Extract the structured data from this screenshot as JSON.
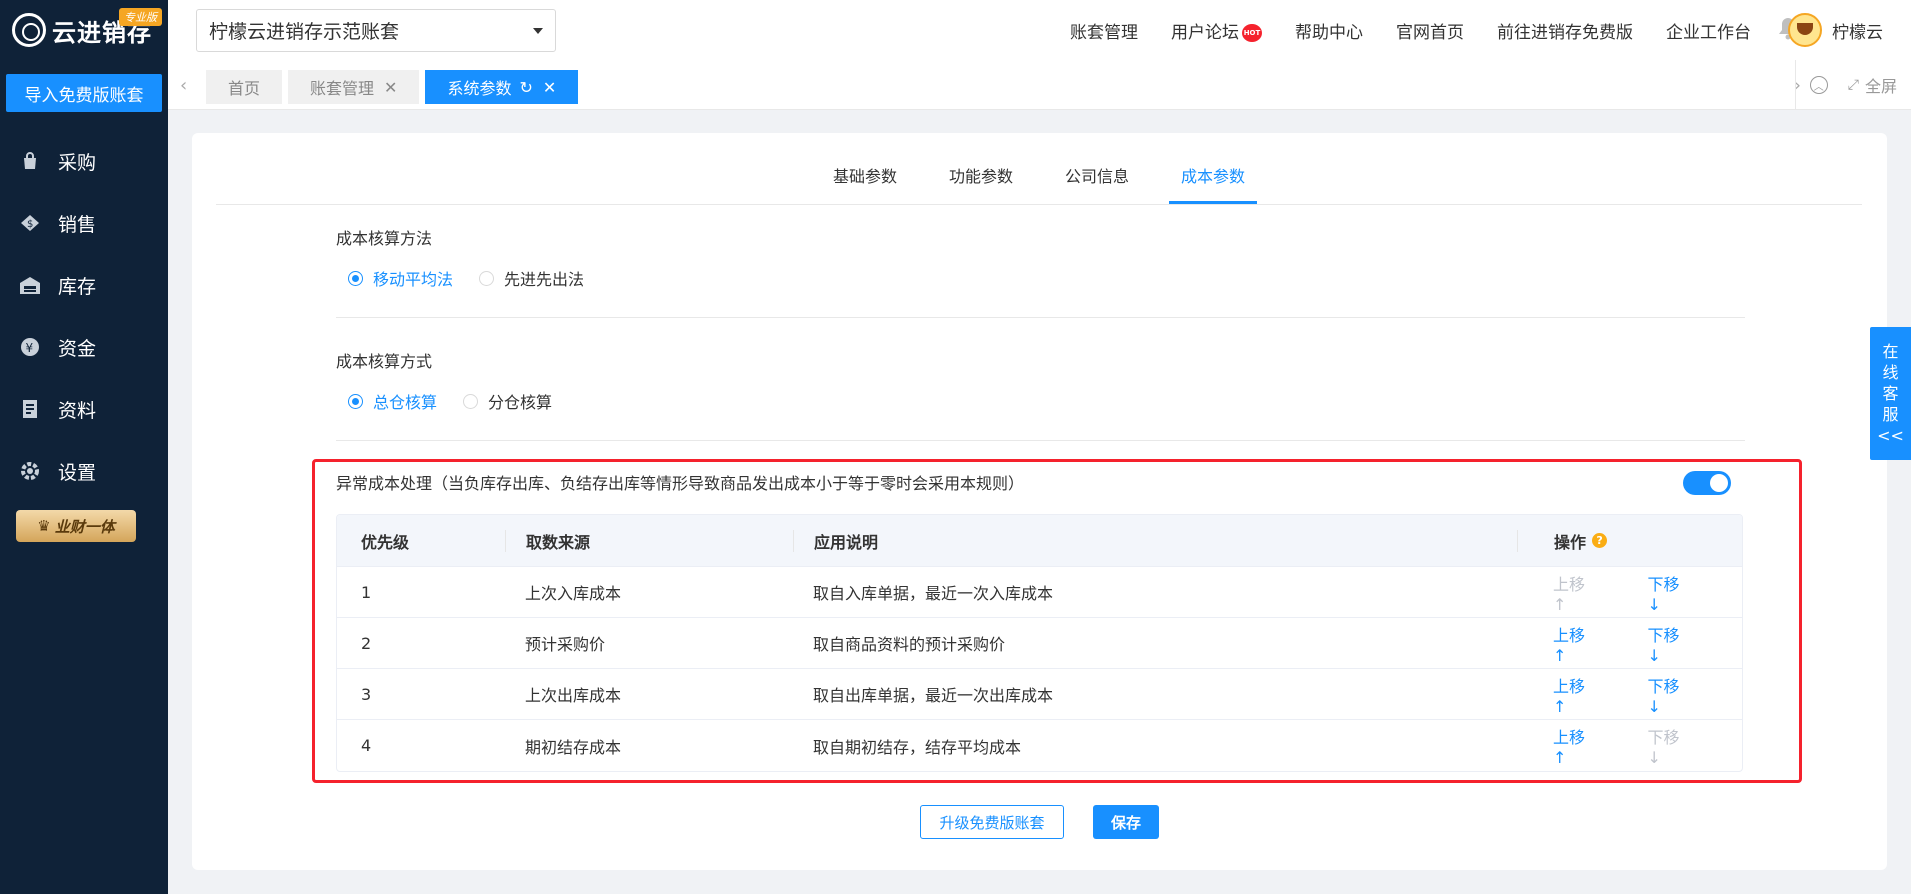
{
  "sidebar": {
    "logo_text": "云进销存",
    "pro_badge": "专业版",
    "import_button": "导入免费版账套",
    "items": [
      {
        "label": "采购",
        "icon": "shopping-bag-icon"
      },
      {
        "label": "销售",
        "icon": "sales-tag-icon"
      },
      {
        "label": "库存",
        "icon": "warehouse-icon"
      },
      {
        "label": "资金",
        "icon": "yen-coin-icon"
      },
      {
        "label": "资料",
        "icon": "document-icon"
      },
      {
        "label": "设置",
        "icon": "gear-icon"
      }
    ],
    "promo_label": "业财一体"
  },
  "topbar": {
    "account": "柠檬云进销存示范账套",
    "nav": [
      "账套管理",
      "用户论坛",
      "帮助中心",
      "官网首页",
      "前往进销存免费版",
      "企业工作台"
    ],
    "hot_badge": "HOT",
    "username": "柠檬云"
  },
  "tabs": {
    "items": [
      "首页",
      "账套管理",
      "系统参数"
    ],
    "fullscreen": "全屏"
  },
  "panel": {
    "tabs": [
      "基础参数",
      "功能参数",
      "公司信息",
      "成本参数"
    ],
    "method_title": "成本核算方法",
    "method_options": [
      "移动平均法",
      "先进先出法"
    ],
    "mode_title": "成本核算方式",
    "mode_options": [
      "总仓核算",
      "分仓核算"
    ],
    "abnormal_title": "异常成本处理（当负库存出库、负结存出库等情形导致商品发出成本小于等于零时会采用本规则）",
    "table": {
      "headers": [
        "优先级",
        "取数来源",
        "应用说明",
        "操作"
      ],
      "rows": [
        {
          "priority": "1",
          "source": "上次入库成本",
          "desc": "取自入库单据，最近一次入库成本",
          "up": "上移↑",
          "down": "下移↓"
        },
        {
          "priority": "2",
          "source": "预计采购价",
          "desc": "取自商品资料的预计采购价",
          "up": "上移↑",
          "down": "下移↓"
        },
        {
          "priority": "3",
          "source": "上次出库成本",
          "desc": "取自出库单据，最近一次出库成本",
          "up": "上移↑",
          "down": "下移↓"
        },
        {
          "priority": "4",
          "source": "期初结存成本",
          "desc": "取自期初结存，结存平均成本",
          "up": "上移↑",
          "down": "下移↓"
        }
      ]
    },
    "upgrade_button": "升级免费版账套",
    "save_button": "保存"
  },
  "cs_float": [
    "在",
    "线",
    "客",
    "服",
    "<<"
  ],
  "colors": {
    "accent": "#1890ff",
    "sidebar_bg": "#0f2238",
    "highlight": "#f5222d"
  }
}
